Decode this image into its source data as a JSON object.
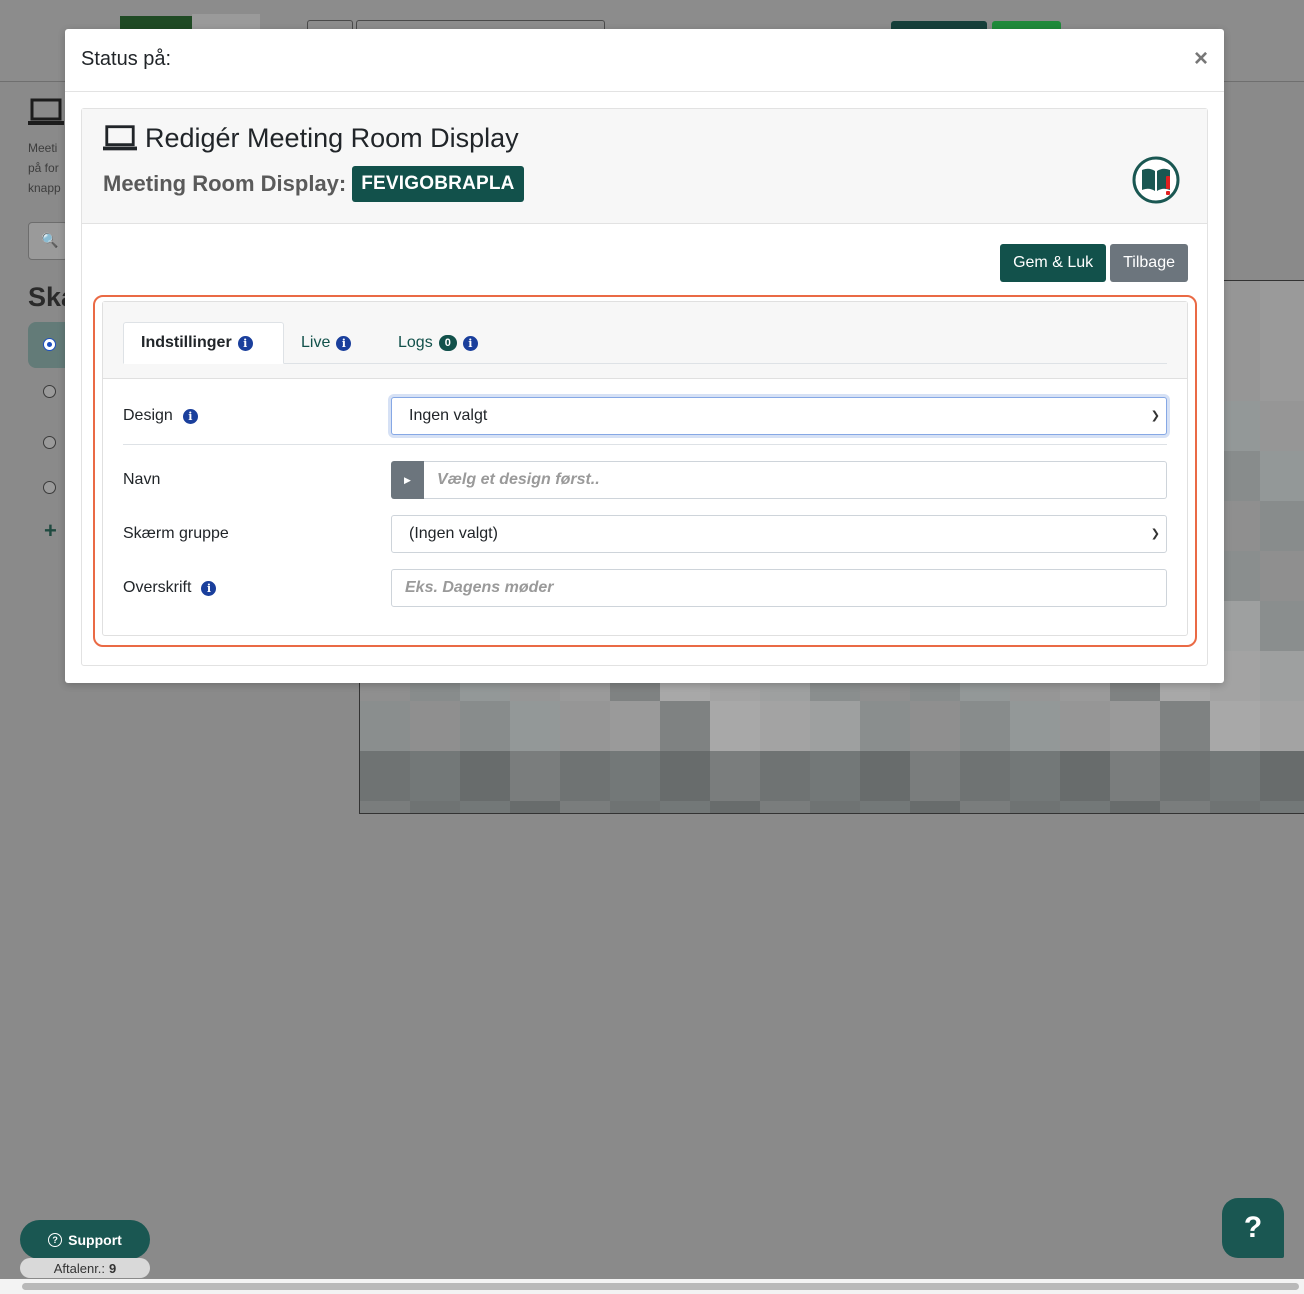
{
  "background": {
    "heading_fragment": "Ska",
    "text_lines": [
      "Meeti",
      "på for",
      "knapp"
    ]
  },
  "modal": {
    "title": "Status på:",
    "close_glyph": "×",
    "card": {
      "title": "Redigér Meeting Room Display",
      "subtitle_label": "Meeting Room Display:",
      "subtitle_badge": "FEVIGOBRAPLA",
      "help_icon": "book-warning-icon"
    },
    "actions": {
      "save_close_label": "Gem & Luk",
      "back_label": "Tilbage"
    },
    "tabs": [
      {
        "label": "Indstillinger",
        "active": true
      },
      {
        "label": "Live",
        "active": false
      },
      {
        "label": "Logs",
        "active": false,
        "badge": "0"
      }
    ],
    "form": {
      "design": {
        "label": "Design",
        "value": "Ingen valgt"
      },
      "navn": {
        "label": "Navn",
        "placeholder": "Vælg et design først.."
      },
      "skaerm_gruppe": {
        "label": "Skærm gruppe",
        "value": "(Ingen valgt)"
      },
      "overskrift": {
        "label": "Overskrift",
        "placeholder": "Eks. Dagens møder"
      }
    }
  },
  "widgets": {
    "support_label": "Support",
    "aftale_label": "Aftalenr.:",
    "aftale_value": "9",
    "help_glyph": "?"
  },
  "colors": {
    "primary": "#12514b",
    "secondary": "#6c757d",
    "highlight": "#ea6a45",
    "info": "#1a3f9c"
  }
}
